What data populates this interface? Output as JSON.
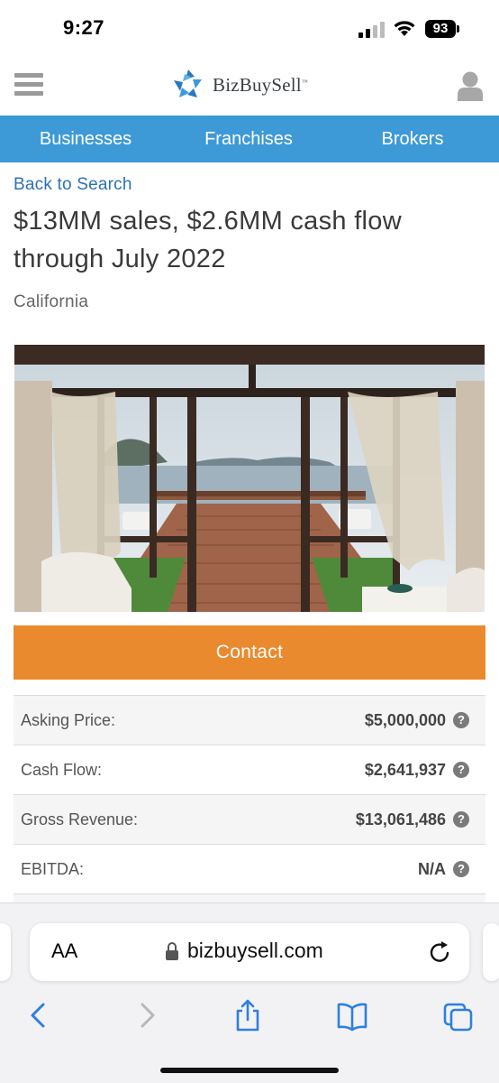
{
  "status_bar": {
    "time": "9:27",
    "battery": "93"
  },
  "header": {
    "logo_text": "BizBuySell",
    "logo_tm": "™"
  },
  "nav": {
    "items": [
      "Businesses",
      "Franchises",
      "Brokers"
    ]
  },
  "listing": {
    "back_label": "Back to Search",
    "title": "$13MM sales, $2.6MM cash flow through July 2022",
    "location": "California",
    "contact_label": "Contact"
  },
  "financials": [
    {
      "label": "Asking Price:",
      "value": "$5,000,000"
    },
    {
      "label": "Cash Flow:",
      "value": "$2,641,937"
    },
    {
      "label": "Gross Revenue:",
      "value": "$13,061,486"
    },
    {
      "label": "EBITDA:",
      "value": "N/A"
    }
  ],
  "help_symbol": "?",
  "browser": {
    "aa_label": "AA",
    "url": "bizbuysell.com"
  },
  "colors": {
    "nav_blue": "#3e9ad7",
    "contact_orange": "#ea8a2e",
    "link_blue": "#2a71b5"
  },
  "icons": [
    "hamburger-icon",
    "logo-icon",
    "user-icon",
    "help-icon",
    "lock-icon",
    "reload-icon",
    "back-icon",
    "forward-icon",
    "share-icon",
    "bookmarks-icon",
    "tabs-icon"
  ]
}
